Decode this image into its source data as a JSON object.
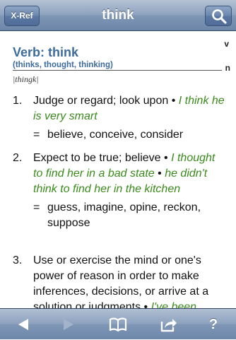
{
  "navbar": {
    "xref_label": "X-Ref",
    "title": "think",
    "search_icon": "search-icon"
  },
  "entry": {
    "corner_top": "v",
    "corner_bottom": "n",
    "headword": "Verb: think",
    "inflections": "(thinks, thought, thinking)",
    "pronunciation": "|thingk|",
    "senses": [
      {
        "number": "1.",
        "definition": "Judge or regard; look upon",
        "examples": [
          "I think he is very smart"
        ],
        "synonyms": "believe, conceive, consider"
      },
      {
        "number": "2.",
        "definition": "Expect to be true; believe",
        "examples": [
          "I thought to find her in a bad state",
          "he didn't think to find her in the kitchen"
        ],
        "synonyms": "guess, imagine, opine, reckon, suppose"
      },
      {
        "number": "3.",
        "definition": "Use or exercise the mind or one's power of reason in order to make inferences, decisions, or arrive at a solution or judgments",
        "examples": [
          "I've been"
        ],
        "synonyms": ""
      }
    ]
  },
  "toolbar": {
    "back_icon": "back-arrow-icon",
    "forward_icon": "forward-arrow-icon",
    "book_icon": "open-book-icon",
    "share_icon": "share-icon",
    "help_label": "?"
  },
  "colors": {
    "headword": "#3d6b9c",
    "example": "#3a8a1c",
    "bar_top": "#b4c2d4",
    "bar_bottom": "#6d87aa"
  }
}
